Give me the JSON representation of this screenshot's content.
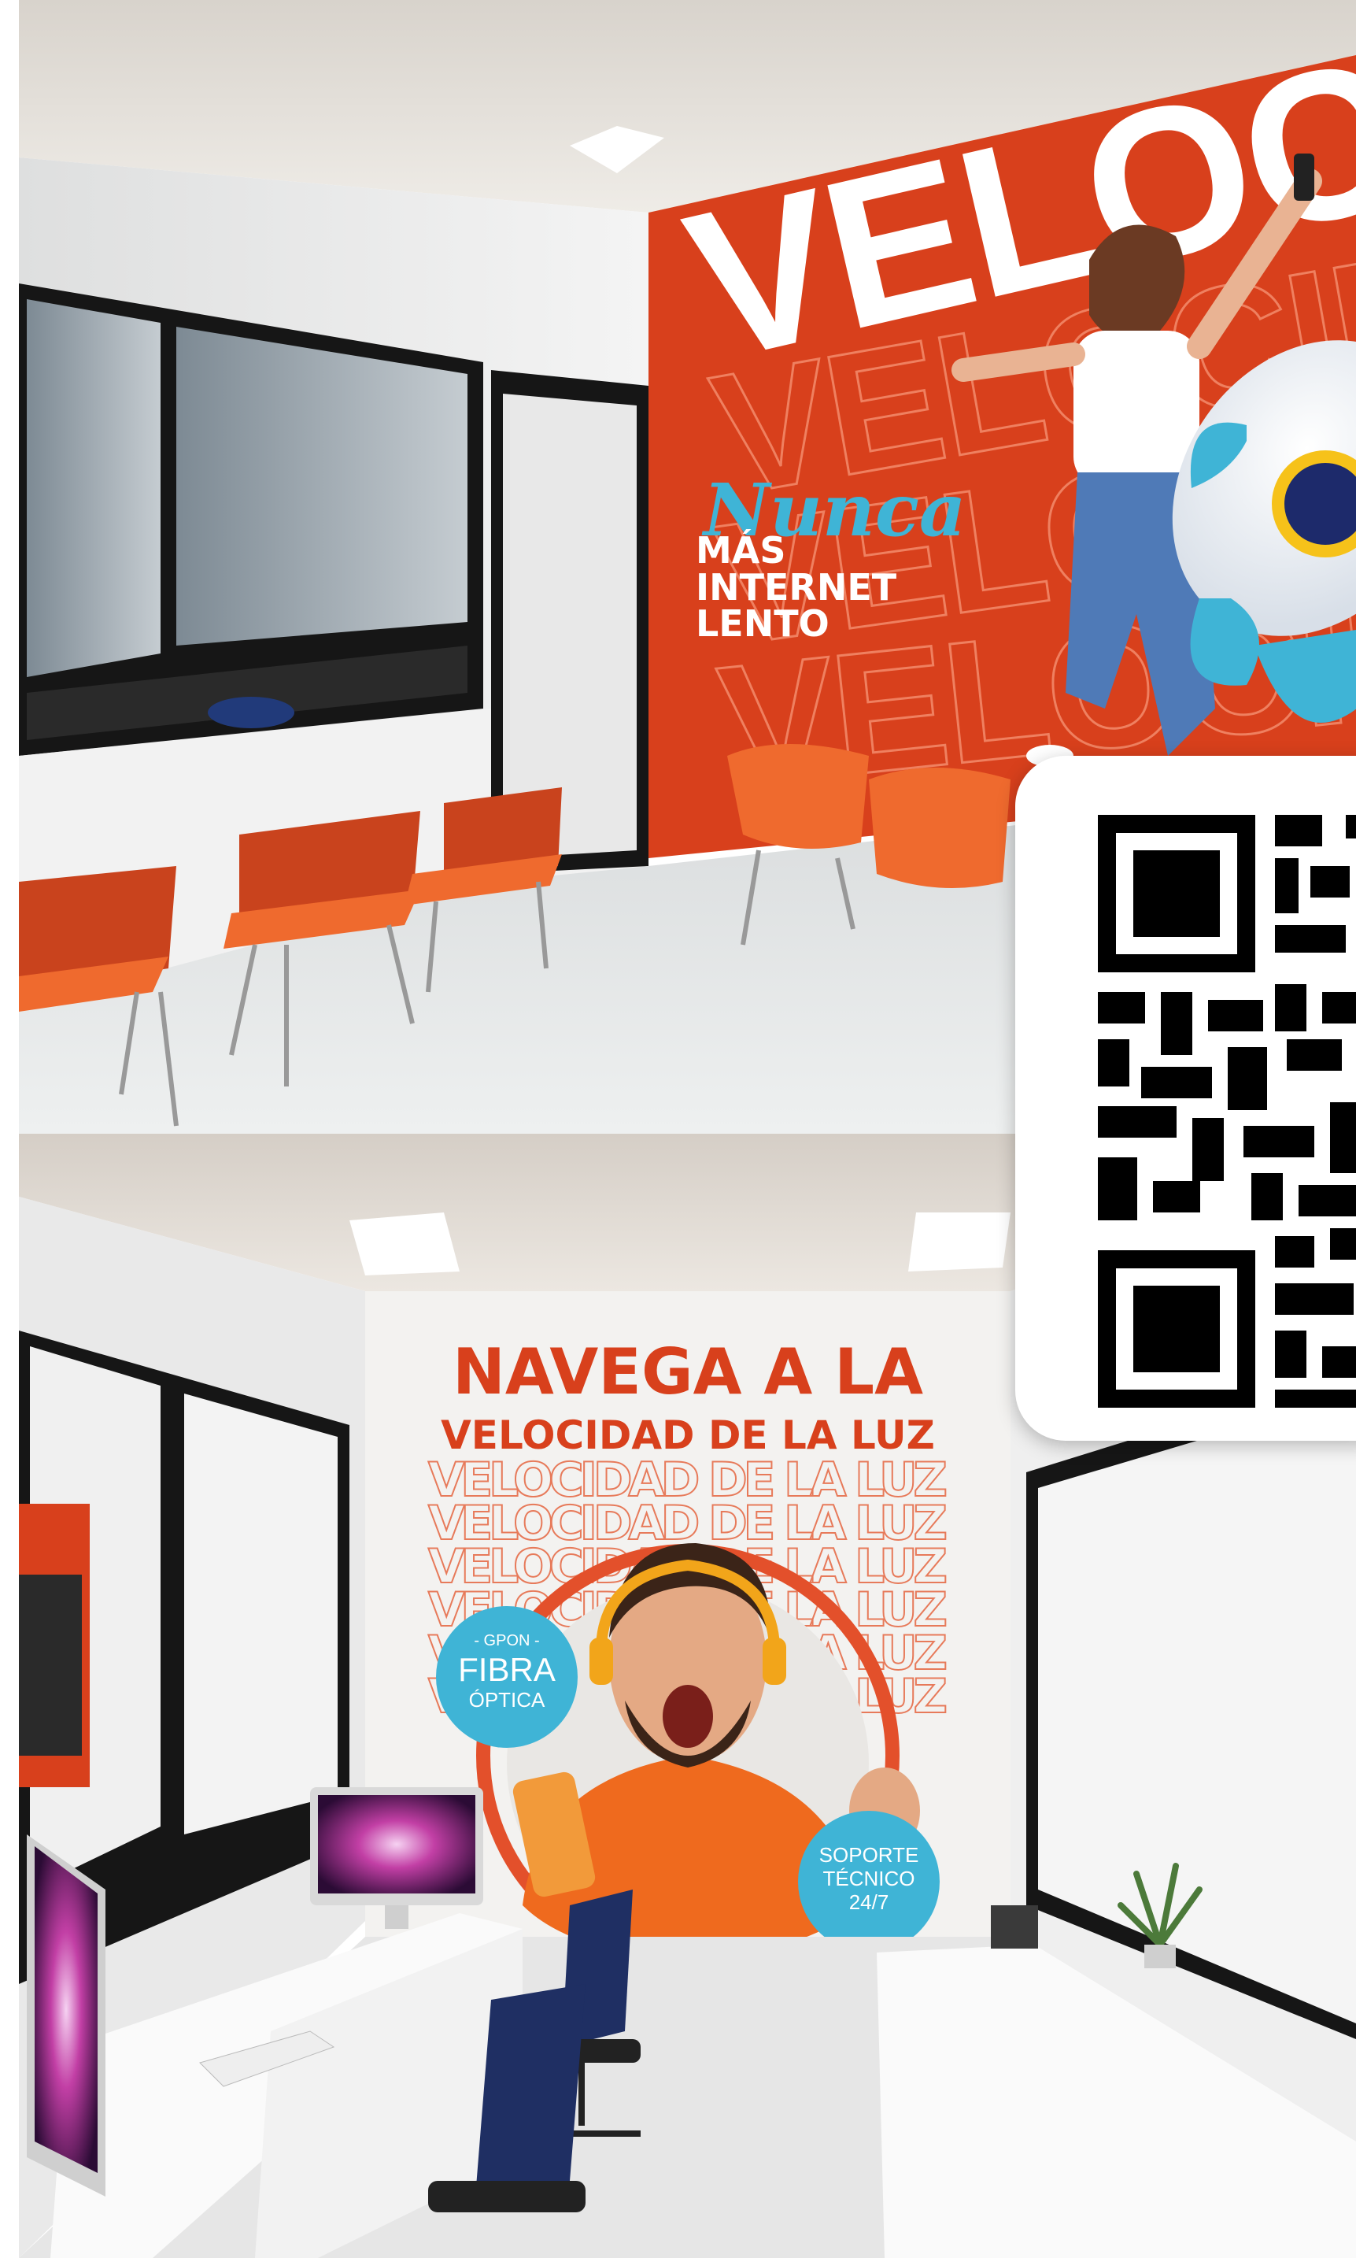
{
  "top_wall": {
    "big_word": "VELOCID",
    "echo_word": "VELOCIDAD",
    "slogan_script": "Nunca",
    "slogan_lines": [
      "MÁS",
      "INTERNET",
      "LENTO"
    ]
  },
  "bottom_wall": {
    "headline_line1": "NAVEGA A LA",
    "headline_line2": "VELOCIDAD DE LA LUZ",
    "repeat_line": "VELOCIDAD DE LA LUZ",
    "badge_fibra": {
      "top": "- GPON -",
      "mid": "FIBRA",
      "bottom": "ÓPTICA"
    },
    "badge_soporte": {
      "line1": "SOPORTE",
      "line2": "TÉCNICO",
      "line3": "24/7"
    }
  },
  "qr": {
    "icon": "qr-code-icon"
  },
  "colors": {
    "brand_orange": "#d8401c",
    "accent_blue": "#3fb4d6",
    "chair_orange": "#ef6a2e",
    "frame_black": "#161616"
  }
}
